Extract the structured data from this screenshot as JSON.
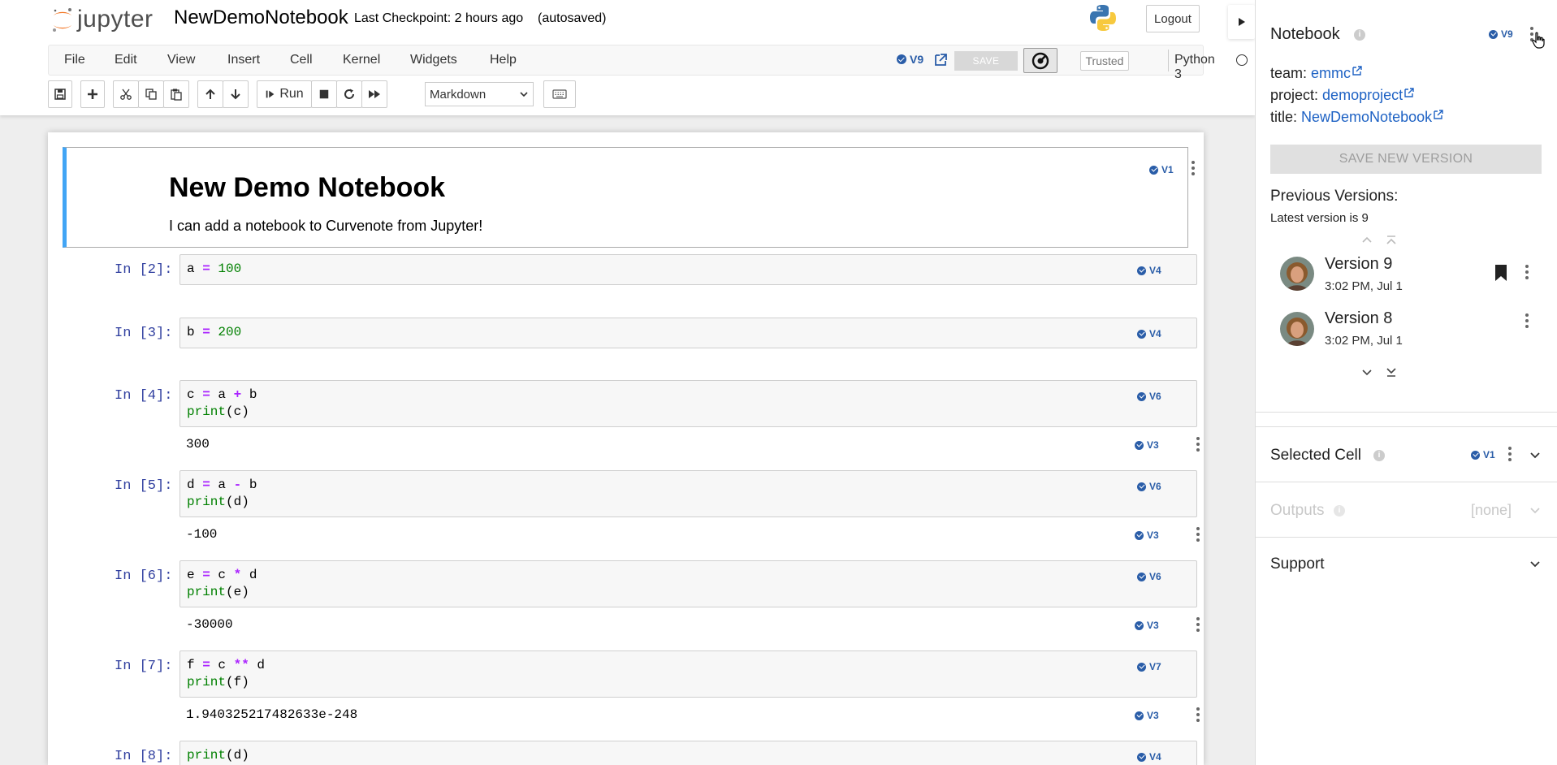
{
  "header": {
    "logo_text": "jupyter",
    "notebook_name": "NewDemoNotebook",
    "checkpoint": "Last Checkpoint: 2 hours ago",
    "autosave_status": "(autosaved)",
    "logout_label": "Logout"
  },
  "menubar": {
    "items": [
      "File",
      "Edit",
      "View",
      "Insert",
      "Cell",
      "Kernel",
      "Widgets",
      "Help"
    ],
    "version_badge": "V9",
    "save_label": "SAVE",
    "trusted_label": "Trusted",
    "kernel_name": "Python 3"
  },
  "toolbar": {
    "run_label": "Run",
    "cell_type": "Markdown"
  },
  "notebook": {
    "markdown_cell": {
      "heading": "New Demo Notebook",
      "text": "I can add a notebook to Curvenote from Jupyter!",
      "version": "V1"
    },
    "cells": [
      {
        "prompt": "In [2]:",
        "lines": [
          "a = 100"
        ],
        "version": "V4",
        "output": null,
        "output_version": null
      },
      {
        "prompt": "In [3]:",
        "lines": [
          "b = 200"
        ],
        "version": "V4",
        "output": null,
        "output_version": null
      },
      {
        "prompt": "In [4]:",
        "lines": [
          "c = a + b",
          "print(c)"
        ],
        "version": "V6",
        "output": "300",
        "output_version": "V3"
      },
      {
        "prompt": "In [5]:",
        "lines": [
          "d = a - b",
          "print(d)"
        ],
        "version": "V6",
        "output": "-100",
        "output_version": "V3"
      },
      {
        "prompt": "In [6]:",
        "lines": [
          "e = c * d",
          "print(e)"
        ],
        "version": "V6",
        "output": "-30000",
        "output_version": "V3"
      },
      {
        "prompt": "In [7]:",
        "lines": [
          "f = c ** d",
          "print(f)"
        ],
        "version": "V7",
        "output": "1.940325217482633e-248",
        "output_version": "V3"
      },
      {
        "prompt": "In [8]:",
        "lines": [
          "print(d)"
        ],
        "version": "V4",
        "output": null,
        "output_version": null
      }
    ]
  },
  "sidepanel": {
    "title": "Notebook",
    "version_badge": "V9",
    "team_label": "team:",
    "team_value": "emmc",
    "project_label": "project:",
    "project_value": "demoproject",
    "title_label": "title:",
    "title_value": "NewDemoNotebook",
    "save_new_version": "SAVE NEW VERSION",
    "previous_versions_title": "Previous Versions:",
    "latest_version_text": "Latest version is 9",
    "versions": [
      {
        "title": "Version 9",
        "time": "3:02 PM, Jul 1",
        "bookmarked": true
      },
      {
        "title": "Version 8",
        "time": "3:02 PM, Jul 1",
        "bookmarked": false
      }
    ],
    "selected_cell": {
      "title": "Selected Cell",
      "version": "V1"
    },
    "outputs": {
      "title": "Outputs",
      "value": "[none]"
    },
    "support": {
      "title": "Support"
    }
  },
  "colors": {
    "accent_blue": "#2a5da8",
    "markdown_bar": "#42a5f5",
    "prompt_blue": "#303f9f",
    "keyword_purple": "#aa22ff",
    "number_green": "#008000"
  }
}
